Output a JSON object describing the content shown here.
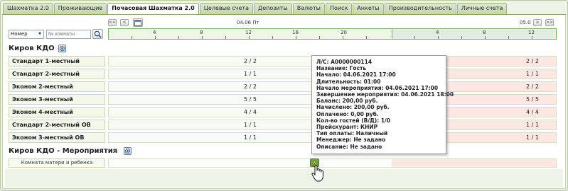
{
  "tabs": [
    "Шахматка 2.0",
    "Проживающие",
    "Почасовая Шахматка 2.0",
    "Целевые счета",
    "Депозиты",
    "Валюты",
    "Поиск",
    "Анкеты",
    "Производительность",
    "Личные счета"
  ],
  "active_tab_index": 2,
  "navigation": {
    "first_label": "<<",
    "prev_label": "<",
    "next_label": ">",
    "last_label": ">>",
    "date_left": "04.06 Пт",
    "date_right": "05.0"
  },
  "timeline": {
    "ticks_day1": [
      "4",
      "8",
      "12",
      "16",
      "20"
    ],
    "ticks_day2": [
      "4",
      "8",
      "12"
    ]
  },
  "filter": {
    "select_value": "Номер",
    "search_placeholder": "№ комнаты"
  },
  "sections": [
    {
      "title": "Киров КДО",
      "rows": [
        {
          "label": "Стандарт 1-местный",
          "left": "2 / 2",
          "right": "2 / 2"
        },
        {
          "label": "Стандарт 2-местный",
          "left": "1 / 1",
          "right": "1 / 1"
        },
        {
          "label": "Эконом 2-местный",
          "left": "2 / 2",
          "right": "2 / 2"
        },
        {
          "label": "Эконом 3-местный",
          "left": "5 / 5",
          "right": "5 / 5"
        },
        {
          "label": "Эконом 4-местный",
          "left": "4 / 4",
          "right": "4 / 4"
        },
        {
          "label": "Стандарт 2-местный ОВ",
          "left": "1 / 1",
          "right": "1 / 1"
        },
        {
          "label": "Эконом 3-местный ОВ",
          "left": "1 / 1",
          "right": "1 / 1"
        }
      ]
    },
    {
      "title": "Киров КДО - Мероприятия",
      "rows": [
        {
          "label": "Комната матери и ребенка"
        }
      ]
    }
  ],
  "tooltip": [
    "Л/С: A0000000114",
    "Название: Гость",
    "Начало: 04.06.2021 17:00",
    "Длительность: 01:00",
    "Начало мероприятия: 04.06.2021 17:00",
    "Завершение мероприятия: 04.06.2021 18:00",
    "Баланс: 200,00 руб.",
    "Начислено: 200,00 руб.",
    "Оплачено: 0,00 руб.",
    "Кол-во гостей (В/Д): 1/0",
    "Прейскурант: КНИР",
    "Тип оплаты: Наличный",
    "Менеджер: Не задано",
    "Описание: Не задано"
  ],
  "icons": {
    "calendar": "calendar-icon",
    "search": "search-icon",
    "settings": "gear-icon",
    "event": "event-icon",
    "cursor": "hand-cursor-icon"
  },
  "colors": {
    "tab_active": "#ffffff",
    "timeline_border": "#7ab36a",
    "pink_zone": "#fde7e2",
    "event_marker": "#6fa34a"
  }
}
